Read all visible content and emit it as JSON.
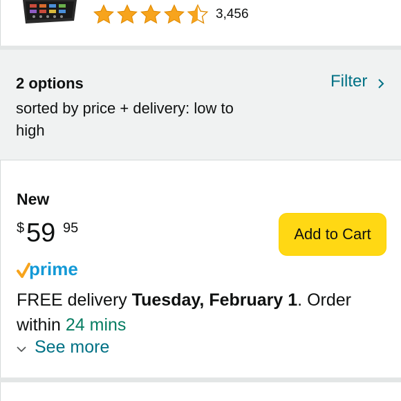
{
  "product": {
    "thumbnail_icon": "product-thumbnail",
    "rating": {
      "stars": 4.5,
      "out_of": 5,
      "count": "3,456",
      "star_color": "#f7a41d"
    }
  },
  "options": {
    "title": "2 options",
    "sort": "sorted by price + delivery: low to high",
    "filter_label": "Filter",
    "filter_icon": "chevron-right-icon"
  },
  "offer": {
    "condition": "New",
    "price": {
      "symbol": "$",
      "whole": "59",
      "fraction": "95"
    },
    "add_to_cart": "Add to Cart",
    "prime": {
      "check_icon": "prime-check-icon",
      "label": "prime"
    },
    "delivery": {
      "prefix": "FREE delivery ",
      "date": "Tuesday, February 1",
      "middle": ". Order within ",
      "countdown": "24 mins"
    },
    "see_more": "See more",
    "see_more_icon": "chevron-down-icon"
  },
  "colors": {
    "link": "#007185",
    "add_to_cart": "#ffd814",
    "prime_blue": "#1399d6",
    "prime_check": "#f7a41d",
    "countdown_green": "#067d62",
    "panel_bg": "#f0f2f2"
  }
}
